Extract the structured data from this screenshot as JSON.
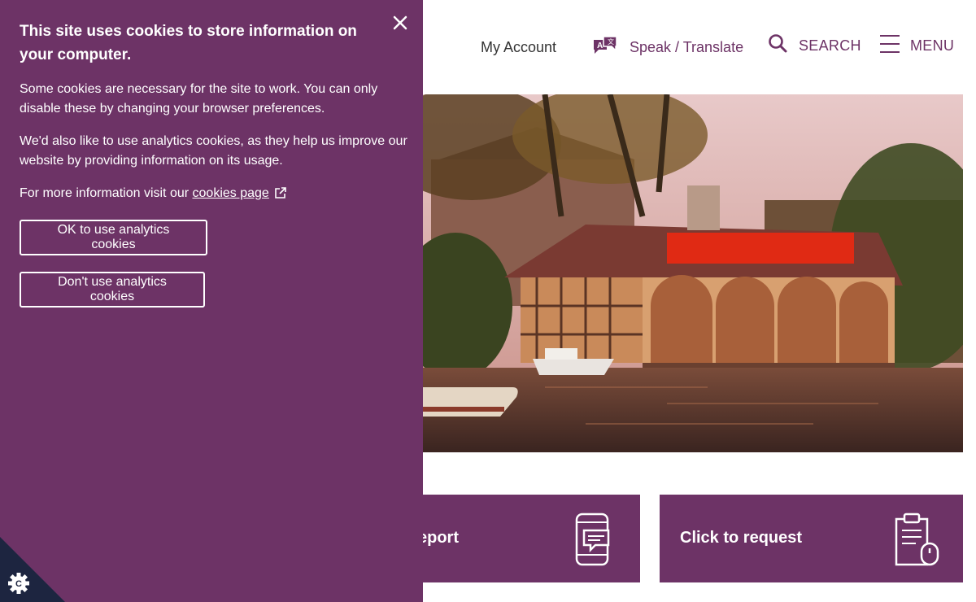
{
  "header": {
    "account_label": "My Account",
    "speak_label": "Speak / Translate",
    "search_label": "SEARCH",
    "menu_label": "MENU"
  },
  "cards": [
    {
      "label": "eport",
      "icon": "phone-chat-icon"
    },
    {
      "label": "Click to request",
      "icon": "clipboard-mouse-icon"
    }
  ],
  "cookie": {
    "title": "This site uses cookies to store information on your computer.",
    "para1": "Some cookies are necessary for the site to work. You can only disable these by changing your browser preferences.",
    "para2": "We'd also like to use analytics cookies, as they help us improve our website by providing information on its usage.",
    "para3_prefix": "For more information visit our ",
    "link_text": "cookies page",
    "ok_button": "OK to use analytics cookies",
    "dont_button": "Don't use analytics cookies"
  },
  "colors": {
    "brand_purple": "#6d3366",
    "corner_dark": "#1d2540"
  },
  "icons": [
    "close-icon",
    "external-link-icon",
    "translate-icon",
    "search-icon",
    "hamburger-icon",
    "cookie-settings-icon"
  ]
}
